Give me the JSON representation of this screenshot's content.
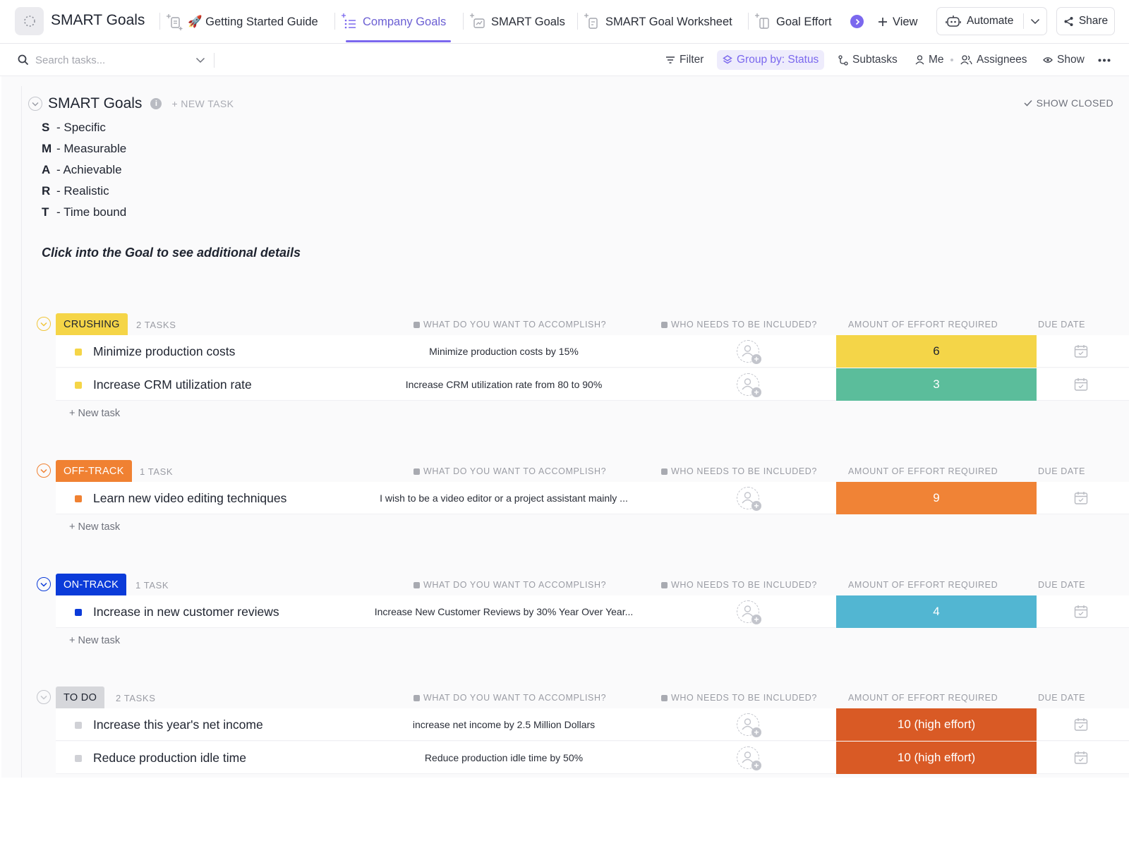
{
  "header": {
    "space_title": "SMART Goals",
    "tabs": [
      {
        "label": "🚀 Getting Started Guide"
      },
      {
        "label": "Company Goals"
      },
      {
        "label": "SMART Goals"
      },
      {
        "label": "SMART Goal Worksheet"
      },
      {
        "label": "Goal Effort"
      }
    ],
    "view_label": "View",
    "automate_label": "Automate",
    "share_label": "Share",
    "accent_color": "#7b68ee"
  },
  "toolbar": {
    "search_placeholder": "Search tasks...",
    "filter_label": "Filter",
    "group_by_label": "Group by: Status",
    "subtasks_label": "Subtasks",
    "me_label": "Me",
    "assignees_label": "Assignees",
    "show_label": "Show"
  },
  "list": {
    "title": "SMART Goals",
    "new_task_label": "+ NEW TASK",
    "show_closed_label": "SHOW CLOSED",
    "smart_definitions": [
      {
        "letter": "S",
        "text": "- Specific"
      },
      {
        "letter": "M",
        "text": "- Measurable"
      },
      {
        "letter": "A",
        "text": "- Achievable"
      },
      {
        "letter": "R",
        "text": "- Realistic"
      },
      {
        "letter": "T",
        "text": "- Time bound"
      }
    ],
    "note": "Click into the Goal to see additional details",
    "columns": {
      "accomplish": "WHAT DO YOU WANT TO ACCOMPLISH?",
      "included": "WHO NEEDS TO BE INCLUDED?",
      "effort": "AMOUNT OF EFFORT REQUIRED",
      "due": "DUE DATE"
    },
    "new_task_row_label": "+ New task"
  },
  "groups": [
    {
      "status": "CRUSHING",
      "count_label": "2 TASKS",
      "badge_bg": "#f5d547",
      "badge_fg": "#1f2430",
      "toggle_color": "#f0c53a",
      "tasks": [
        {
          "name": "Minimize production costs",
          "accomplish": "Minimize production costs by 15%",
          "effort": "6",
          "effort_bg": "#f4d548",
          "effort_fg": "#1f2430"
        },
        {
          "name": "Increase CRM utilization rate",
          "accomplish": "Increase CRM utilization rate from 80 to 90%",
          "effort": "3",
          "effort_bg": "#5bbd9b",
          "effort_fg": "#ffffff"
        }
      ]
    },
    {
      "status": "OFF-TRACK",
      "count_label": "1 TASK",
      "badge_bg": "#f08132",
      "badge_fg": "#ffffff",
      "toggle_color": "#f08132",
      "tasks": [
        {
          "name": "Learn new video editing techniques",
          "accomplish": "I wish to be a video editor or a project assistant mainly ...",
          "effort": "9",
          "effort_bg": "#f08336",
          "effort_fg": "#ffffff"
        }
      ]
    },
    {
      "status": "ON-TRACK",
      "count_label": "1 TASK",
      "badge_bg": "#0b3bd9",
      "badge_fg": "#ffffff",
      "toggle_color": "#0b3bd9",
      "tasks": [
        {
          "name": "Increase in new customer reviews",
          "accomplish": "Increase New Customer Reviews by 30% Year Over Year...",
          "effort": "4",
          "effort_bg": "#52b6d2",
          "effort_fg": "#ffffff"
        }
      ]
    },
    {
      "status": "TO DO",
      "count_label": "2 TASKS",
      "badge_bg": "#d6d7db",
      "badge_fg": "#1f2430",
      "toggle_color": "#c4c6cc",
      "tasks": [
        {
          "name": "Increase this year's net income",
          "accomplish": "increase net income by 2.5 Million Dollars",
          "effort": "10 (high effort)",
          "effort_bg": "#d95a25",
          "effort_fg": "#ffffff"
        },
        {
          "name": "Reduce production idle time",
          "accomplish": "Reduce production idle time by 50%",
          "effort": "10 (high effort)",
          "effort_bg": "#d95a25",
          "effort_fg": "#ffffff"
        }
      ]
    }
  ]
}
